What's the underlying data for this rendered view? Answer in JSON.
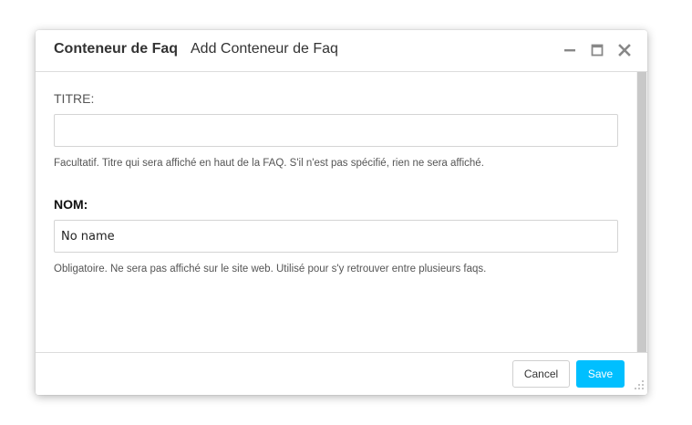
{
  "header": {
    "title": "Conteneur de Faq",
    "subtitle": "Add Conteneur de Faq",
    "controls": {
      "minimize_icon": "minimize-icon",
      "maximize_icon": "maximize-icon",
      "close_icon": "close-icon"
    }
  },
  "form": {
    "titre": {
      "label": "TITRE:",
      "value": "",
      "placeholder": "",
      "help": "Facultatif. Titre qui sera affiché en haut de la FAQ. S'il n'est pas spécifié, rien ne sera affiché."
    },
    "nom": {
      "label": "NOM:",
      "value": "No name",
      "placeholder": "",
      "help": "Obligatoire. Ne sera pas affiché sur le site web. Utilisé pour s'y retrouver entre plusieurs faqs."
    }
  },
  "footer": {
    "cancel_label": "Cancel",
    "save_label": "Save"
  },
  "colors": {
    "save_button": "#00bfff",
    "scrollbar_thumb": "#c8c8c8",
    "border": "#dcdcdc",
    "icon": "#888888"
  }
}
